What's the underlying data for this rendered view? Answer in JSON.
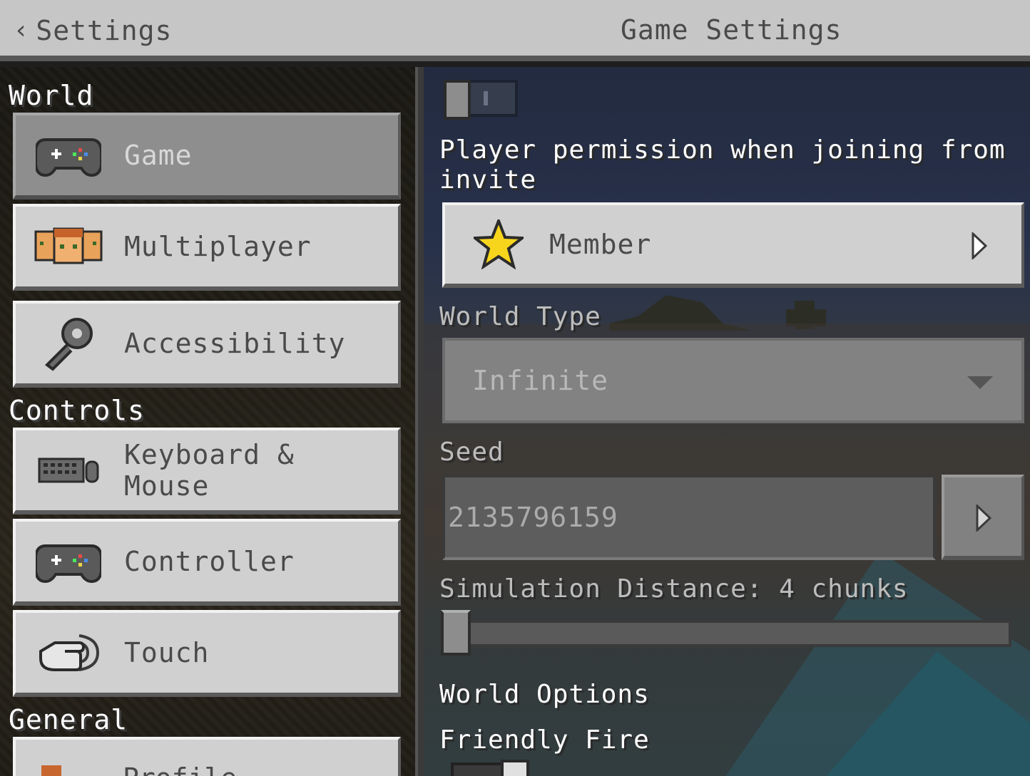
{
  "header": {
    "back_label": "Settings",
    "title": "Game Settings"
  },
  "sidebar": {
    "sections": [
      {
        "title": "World",
        "items": [
          {
            "label": "Game",
            "icon": "gamepad-icon",
            "selected": true
          },
          {
            "label": "Multiplayer",
            "icon": "players-icon"
          },
          {
            "label": "Accessibility",
            "icon": "key-icon"
          }
        ]
      },
      {
        "title": "Controls",
        "items": [
          {
            "label": "Keyboard & Mouse",
            "icon": "keyboard-mouse-icon"
          },
          {
            "label": "Controller",
            "icon": "gamepad-icon"
          },
          {
            "label": "Touch",
            "icon": "touch-icon"
          }
        ]
      },
      {
        "title": "General",
        "items": [
          {
            "label": "Profile",
            "icon": "profile-icon"
          }
        ]
      }
    ]
  },
  "main": {
    "player_permission_label": "Player permission when joining from invite",
    "player_permission_value": "Member",
    "world_type_label": "World Type",
    "world_type_value": "Infinite",
    "seed_label": "Seed",
    "seed_value": "2135796159",
    "simulation_distance_label": "Simulation Distance: 4 chunks",
    "simulation_distance": {
      "value": 4,
      "unit": "chunks"
    },
    "world_options_heading": "World Options",
    "friendly_fire_label": "Friendly Fire",
    "friendly_fire_on": true,
    "top_toggle_on": false
  },
  "colors": {
    "button_face": "#d0d0d0",
    "button_selected": "#8e8e8e",
    "header_bg": "#c6c6c6",
    "star": "#f7d51d"
  }
}
